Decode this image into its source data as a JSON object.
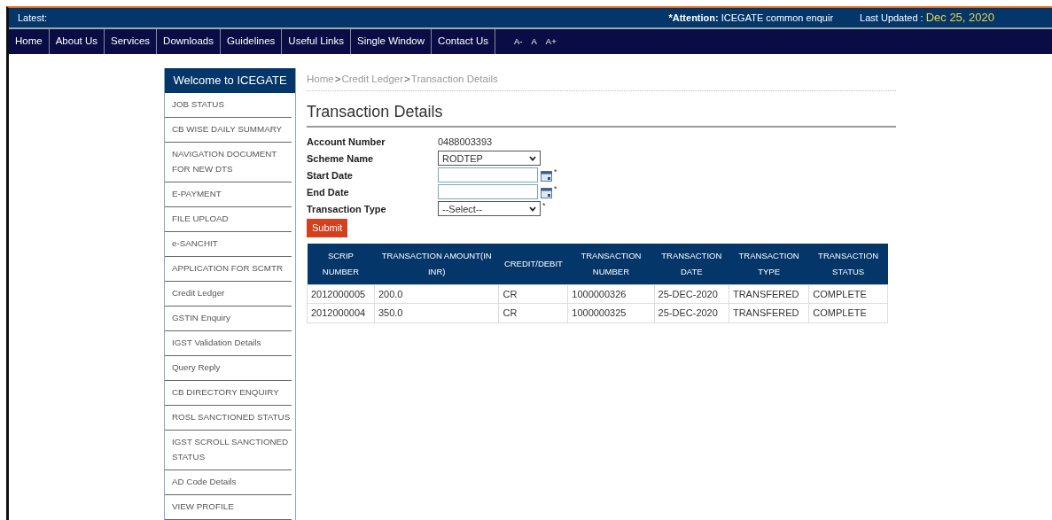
{
  "ticker": {
    "label": "Latest:",
    "attention_label": "*Attention:",
    "attention_text": "ICEGATE common enquir",
    "updated_label": "Last Updated :",
    "updated_value": "Dec 25, 2020"
  },
  "nav": [
    "Home",
    "About Us",
    "Services",
    "Downloads",
    "Guidelines",
    "Useful Links",
    "Single Window",
    "Contact Us"
  ],
  "font_sizes": [
    "A-",
    "A",
    "A+"
  ],
  "sidebar": {
    "title": "Welcome to ICEGATE",
    "items": [
      "JOB STATUS",
      "CB WISE DAILY SUMMARY",
      "NAVIGATION DOCUMENT FOR NEW DTS",
      "E-PAYMENT",
      "FILE UPLOAD",
      "e-SANCHIT",
      "APPLICATION FOR SCMTR",
      "Credit Ledger",
      "GSTIN Enquiry",
      "IGST Validation Details",
      "Query Reply",
      "CB DIRECTORY ENQUIRY",
      "ROSL SANCTIONED STATUS",
      "IGST SCROLL SANCTIONED STATUS",
      "AD Code Details",
      "VIEW PROFILE"
    ]
  },
  "breadcrumb": [
    "Home",
    ">",
    "Credit Ledger",
    ">",
    "Transaction Details"
  ],
  "page_title": "Transaction Details",
  "form": [
    {
      "kind": "text",
      "label": "Account Number",
      "value": "0488003393"
    },
    {
      "kind": "select",
      "label": "Scheme Name",
      "value": "RODTEP",
      "required": false
    },
    {
      "kind": "date",
      "label": "Start Date",
      "required": true
    },
    {
      "kind": "date",
      "label": "End Date",
      "required": true
    },
    {
      "kind": "select",
      "label": "Transaction Type",
      "value": "--Select--",
      "required": true
    }
  ],
  "required_mark": "*",
  "submit": "Submit",
  "table": {
    "columns": [
      "SCRIP NUMBER",
      "TRANSACTION AMOUNT(IN INR)",
      "CREDIT/DEBIT",
      "TRANSACTION NUMBER",
      "TRANSACTION DATE",
      "TRANSACTION TYPE",
      "TRANSACTION STATUS"
    ],
    "rows": [
      [
        "2012000005",
        "200.0",
        "CR",
        "1000000326",
        "25-DEC-2020",
        "TRANSFERED",
        "COMPLETE"
      ],
      [
        "2012000004",
        "350.0",
        "CR",
        "1000000325",
        "25-DEC-2020",
        "TRANSFERED",
        "COMPLETE"
      ]
    ]
  }
}
